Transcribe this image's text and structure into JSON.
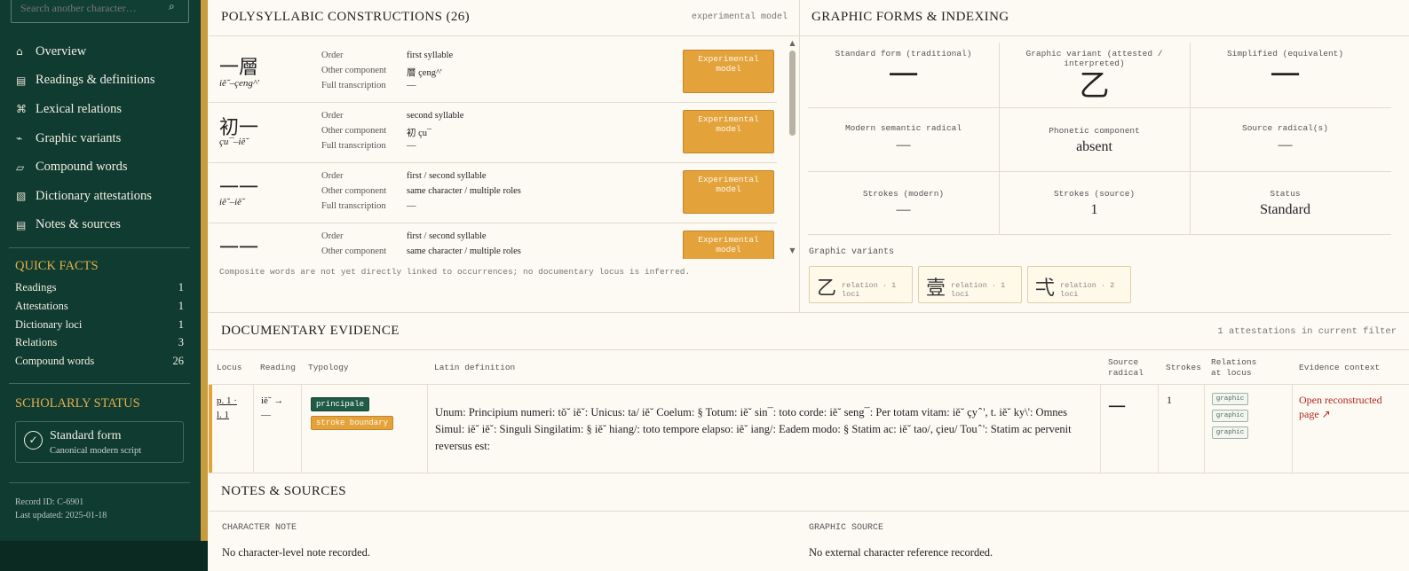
{
  "sidebar": {
    "search_placeholder": "Search another character…",
    "search_icon": "search-icon",
    "nav": [
      {
        "label": "Overview",
        "icon": "⌂"
      },
      {
        "label": "Readings & definitions",
        "icon": "▤"
      },
      {
        "label": "Lexical relations",
        "icon": "⌘"
      },
      {
        "label": "Graphic variants",
        "icon": "⌁"
      },
      {
        "label": "Compound words",
        "icon": "▱"
      },
      {
        "label": "Dictionary attestations",
        "icon": "▧"
      },
      {
        "label": "Notes & sources",
        "icon": "▤"
      }
    ],
    "quick_facts": {
      "title": "QUICK FACTS",
      "rows": [
        {
          "label": "Readings",
          "value": "1"
        },
        {
          "label": "Attestations",
          "value": "1"
        },
        {
          "label": "Dictionary loci",
          "value": "1"
        },
        {
          "label": "Relations",
          "value": "3"
        },
        {
          "label": "Compound words",
          "value": "26"
        }
      ]
    },
    "scholarly_status": {
      "title": "SCHOLARLY STATUS",
      "main": "Standard form",
      "sub": "Canonical modern script"
    },
    "record_id": "Record ID: C-6901",
    "last_updated": "Last updated: 2025-01-18"
  },
  "poly": {
    "title": "POLYSYLLABIC CONSTRUCTIONS (26)",
    "tag": "experimental model",
    "labels": {
      "order": "Order",
      "other": "Other component",
      "full": "Full transcription"
    },
    "button": "Experimental model",
    "rows": [
      {
        "hanzi": "一層",
        "roman": "iĕ˘–çeng^'",
        "order": "first syllable",
        "other": "層 çeng^'",
        "full": "—"
      },
      {
        "hanzi": "初一",
        "roman": "çu¯–iĕ˘",
        "order": "second syllable",
        "other": "初 çu¯",
        "full": "—"
      },
      {
        "hanzi": "一一",
        "roman": "iĕ˘–iĕ˘",
        "order": "first / second syllable",
        "other": "same character / multiple roles",
        "full": "—"
      },
      {
        "hanzi": "一一",
        "roman": "",
        "order": "first / second syllable",
        "other": "same character / multiple roles",
        "full": ""
      }
    ],
    "footnote": "Composite words are not yet directly linked to occurrences; no documentary locus is inferred."
  },
  "graphic": {
    "title": "GRAPHIC FORMS & INDEXING",
    "cells": [
      {
        "label": "Standard form (traditional)",
        "value": "一"
      },
      {
        "label": "Graphic variant (attested / interpreted)",
        "value": "乙"
      },
      {
        "label": "Simplified (equivalent)",
        "value": "一"
      },
      {
        "label": "Modern semantic radical",
        "value": "—"
      },
      {
        "label": "Phonetic component",
        "value": "absent"
      },
      {
        "label": "Source radical(s)",
        "value": "—"
      },
      {
        "label": "Strokes (modern)",
        "value": "—"
      },
      {
        "label": "Strokes (source)",
        "value": "1"
      },
      {
        "label": "Status",
        "value": "Standard"
      }
    ],
    "variants_label": "Graphic variants",
    "variants": [
      {
        "glyph": "乙",
        "rel": "relation · 1 loci"
      },
      {
        "glyph": "壹",
        "rel": "relation · 1 loci"
      },
      {
        "glyph": "弌",
        "rel": "relation · 2 loci"
      }
    ]
  },
  "evidence": {
    "title": "DOCUMENTARY EVIDENCE",
    "count": "1 attestations in current filter",
    "headers": {
      "locus": "Locus",
      "reading": "Reading",
      "typology": "Typology",
      "latin": "Latin definition",
      "source_radical": "Source radical",
      "strokes": "Strokes",
      "relations": "Relations at locus",
      "context": "Evidence context"
    },
    "row": {
      "locus_line1": "p. 1 ·",
      "locus_line2": "l. 1",
      "reading_line1": "iĕ˘ →",
      "reading_line2": "—",
      "tag1": "principale",
      "tag2": "stroke boundary",
      "latin": "Unum: Principium numeri: tŏ˘ iĕ˘: Unicus: ta/ iĕ˘ Coelum: § Totum: iĕ˘ sin¯: toto corde: iĕ˘ seng¯: Per totam vitam: iĕ˘ çy ̂ ', t. iĕ˘ ky\\': Omnes Simul: iĕ˘ iĕ˘: Singuli Singilatim: § iĕ˘ hiang/: toto tempore elapso: iĕ˘ iang/: Eadem modo: § Statim ac: iĕ˘ tao/, çieu/ Tou ̂ ': Statim ac pervenit reversus est:",
      "source_radical": "一",
      "strokes": "1",
      "relations": [
        "graphic",
        "graphic",
        "graphic"
      ],
      "context_link": "Open reconstructed page ↗"
    }
  },
  "notes": {
    "title": "NOTES & SOURCES",
    "char_label": "CHARACTER NOTE",
    "char_value": "No character-level note recorded.",
    "source_label": "GRAPHIC SOURCE",
    "source_value": "No external character reference recorded."
  },
  "colors": {
    "sidebar": "#0f3b30",
    "accent": "#e3b04b",
    "button": "#e4a23b",
    "page": "#fdfaf3",
    "link": "#b3261e"
  }
}
